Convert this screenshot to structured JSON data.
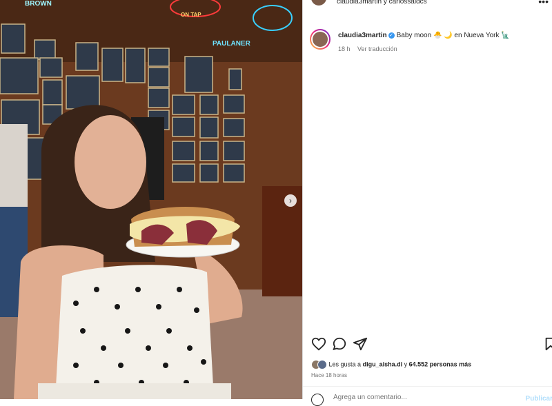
{
  "header": {
    "usernames": "claudia3martin y carlossaidcs",
    "more_icon": "ellipsis-icon"
  },
  "photo": {
    "signs": [
      "BROWN",
      "ON TAP",
      "PAULANER"
    ],
    "next_icon": "chevron-right-icon"
  },
  "caption": {
    "username": "claudia3martin",
    "verified_icon": "verified-badge-icon",
    "text": "Baby moon 🐣 🌙 en Nueva York 🗽",
    "time": "18 h",
    "translate": "Ver traducción"
  },
  "actions": {
    "like_icon": "heart-icon",
    "comment_icon": "comment-icon",
    "share_icon": "send-icon",
    "save_icon": "bookmark-icon"
  },
  "likes": {
    "prefix": "Les gusta a",
    "user": "digu_aisha.di",
    "middle": "y",
    "count": "64.552 personas más"
  },
  "time_ago": "Hace 18 horas",
  "comment": {
    "placeholder": "Agrega un comentario...",
    "post_label": "Publicar"
  },
  "colors": {
    "verified": "#3897f0",
    "post_disabled": "#b2dffc",
    "wall": "#6b3a1f"
  }
}
